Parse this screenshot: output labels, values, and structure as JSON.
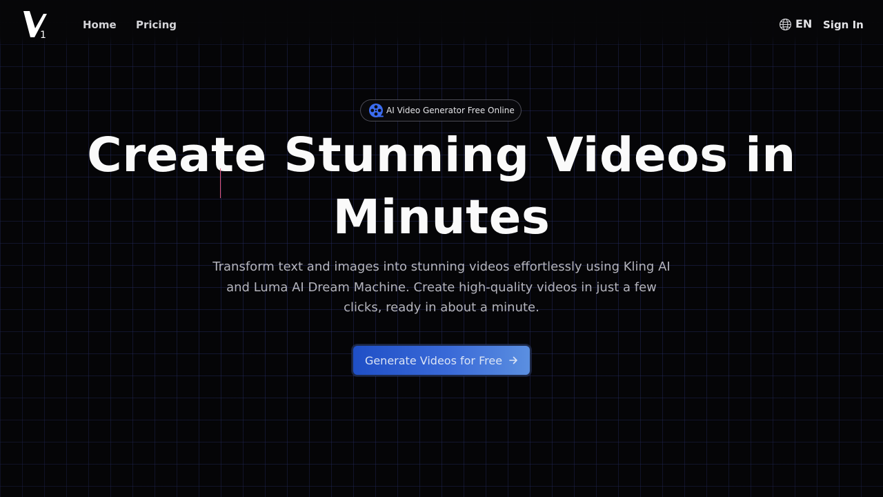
{
  "nav": {
    "logo_text": "V1",
    "links": [
      {
        "label": "Home"
      },
      {
        "label": "Pricing"
      }
    ],
    "language": {
      "label": "EN",
      "icon": "globe-icon"
    },
    "sign_in_label": "Sign In"
  },
  "hero": {
    "badge": {
      "icon": "film-reel-icon",
      "label": "AI Video Generator Free Online"
    },
    "headline": "Create Stunning Videos in Minutes",
    "subtitle": "Transform text and images into stunning videos effortlessly using Kling AI and Luma AI Dream Machine. Create high-quality videos in just a few clicks, ready in about a minute.",
    "cta": {
      "label": "Generate Videos for Free",
      "icon": "arrow-right-icon"
    }
  },
  "colors": {
    "background": "#050507",
    "grid_line": "#28306e",
    "text_primary": "#fafafa",
    "text_muted": "#b4b4bc",
    "accent_blue": "#2b5fd9",
    "badge_icon_blue": "#3b6cf0",
    "cursor_pink": "#e0557a"
  }
}
